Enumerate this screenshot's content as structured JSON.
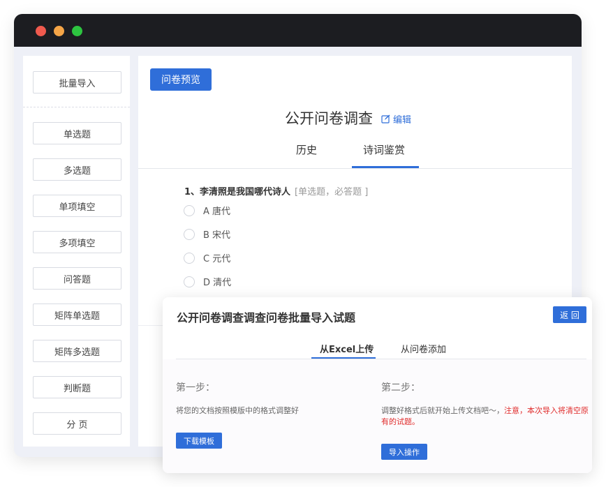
{
  "sidebar": {
    "import_label": "批量导入",
    "items": [
      "单选题",
      "多选题",
      "单项填空",
      "多项填空",
      "问答题",
      "矩阵单选题",
      "矩阵多选题",
      "判断题",
      "分 页"
    ]
  },
  "main": {
    "preview_label": "问卷预览",
    "title": "公开问卷调查",
    "edit_label": "编辑",
    "tabs": [
      "历史",
      "诗词鉴赏"
    ],
    "question": {
      "title": "1、李清照是我国哪代诗人",
      "type": "[单选题，必答题 ]",
      "options": [
        "A 唐代",
        "B 宋代",
        "C 元代",
        "D 清代"
      ]
    }
  },
  "dialog": {
    "title": "公开问卷调查调查问卷批量导入试题",
    "back_label": "返 回",
    "tabs": [
      "从Excel上传",
      "从问卷添加"
    ],
    "step1": {
      "title": "第一步：",
      "desc": "将您的文档按照模版中的格式调整好",
      "button": "下载模板"
    },
    "step2": {
      "title": "第二步：",
      "desc": "调整好格式后就开始上传文档吧～，",
      "warning": "注意，本次导入将清空原有的试题。",
      "button": "导入操作"
    }
  },
  "colors": {
    "accent": "#2f6ed9",
    "warning": "#e02b2b",
    "titlebar": "#1c1d21"
  }
}
